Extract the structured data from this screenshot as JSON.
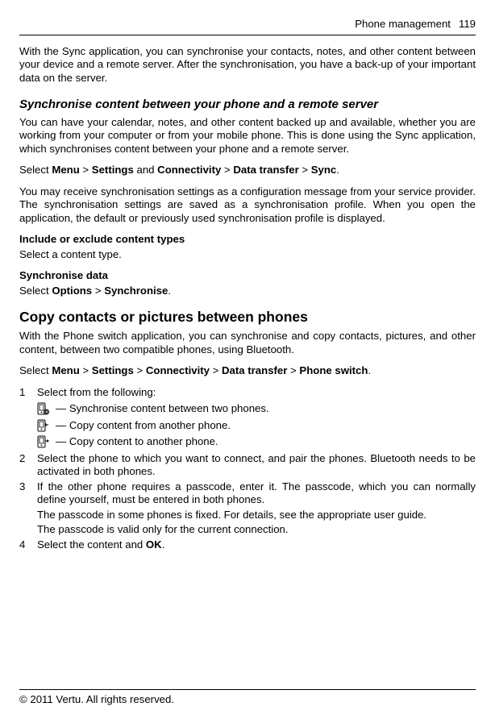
{
  "header": {
    "section": "Phone management",
    "page": "119"
  },
  "intro": "With the Sync application, you can synchronise your contacts, notes, and other content between your device and a remote server. After the synchronisation, you have a back-up of your important data on the server.",
  "sync": {
    "title": "Synchronise content between your phone and a remote server",
    "p1": "You can have your calendar, notes, and other content backed up and available, whether you are working from your computer or from your mobile phone. This is done using the Sync application, which synchronises content between your phone and a remote server.",
    "path": {
      "pre": "Select ",
      "a": "Menu",
      "b": "Settings",
      "c": "Connectivity",
      "d": "Data transfer",
      "e": "Sync",
      "and": " and "
    },
    "p2": "You may receive synchronisation settings as a configuration message from your service provider. The synchronisation settings are saved as a synchronisation profile. When you open the application, the default or previously used synchronisation profile is displayed.",
    "inc_title": "Include or exclude content types",
    "inc_body": "Select a content type.",
    "data_title": "Synchronise data",
    "data_pre": "Select ",
    "data_a": "Options",
    "data_b": "Synchronise"
  },
  "copy": {
    "title": "Copy contacts or pictures between phones",
    "p1": "With the Phone switch application, you can synchronise and copy contacts, pictures, and other content, between two compatible phones, using Bluetooth.",
    "path": {
      "pre": "Select ",
      "a": "Menu",
      "b": "Settings",
      "c": "Connectivity",
      "d": "Data transfer",
      "e": "Phone switch"
    },
    "steps": {
      "s1": "Select from the following:",
      "opt_sync": " — Synchronise content between two phones.",
      "opt_from": " — Copy content from another phone.",
      "opt_to": " — Copy content to another phone.",
      "s2": "Select the phone to which you want to connect, and pair the phones. Bluetooth needs to be activated in both phones.",
      "s3": "If the other phone requires a passcode, enter it. The passcode, which you can normally define yourself, must be entered in both phones.",
      "s3a": "The passcode in some phones is fixed. For details, see the appropriate user guide.",
      "s3b": "The passcode is valid only for the current connection.",
      "s4_pre": "Select the content and ",
      "s4_b": "OK",
      "s4_post": "."
    }
  },
  "footer": "© 2011 Vertu. All rights reserved.",
  "gt": " > "
}
